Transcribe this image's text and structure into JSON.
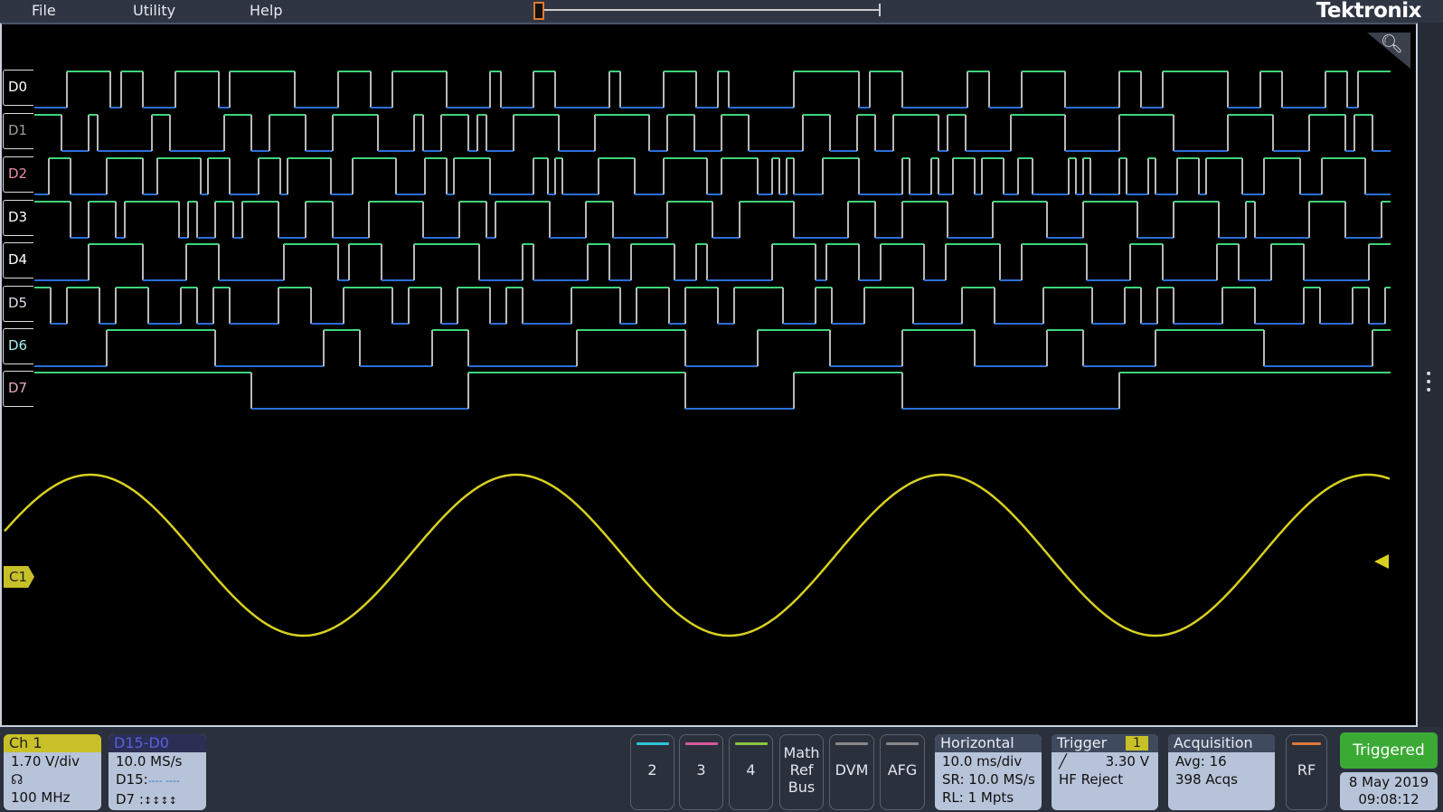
{
  "menu": {
    "items": [
      "File",
      "Utility",
      "Help"
    ],
    "brand": "Tektronix"
  },
  "digital_channels": [
    "D0",
    "D1",
    "D2",
    "D3",
    "D4",
    "D5",
    "D6",
    "D7"
  ],
  "analog_channel_label": "C1",
  "ch1": {
    "title": "Ch 1",
    "scale": "1.70 V/div",
    "bandwidth": "100 MHz",
    "probe_icon": "probe-icon"
  },
  "digital_group": {
    "title": "D15-D0",
    "rate": "10.0 MS/s",
    "d15_label": "D15:",
    "d15_state": "---- ----",
    "d7_label": "D7 :",
    "d7_state": "↕↕↕↕ ↕↕↕↕"
  },
  "channel_buttons": [
    {
      "label": "2",
      "color": "#2ec5d6"
    },
    {
      "label": "3",
      "color": "#d85a9a"
    },
    {
      "label": "4",
      "color": "#8dc63f"
    }
  ],
  "math_ref_bus": [
    "Math",
    "Ref",
    "Bus"
  ],
  "dvm": "DVM",
  "afg": "AFG",
  "horizontal": {
    "title": "Horizontal",
    "scale": "10.0 ms/div",
    "sample_rate": "SR: 10.0 MS/s",
    "record_length": "RL: 1 Mpts"
  },
  "trigger": {
    "title": "Trigger",
    "source": "1",
    "level": "3.30 V",
    "coupling": "HF Reject",
    "slope_icon": "rising-edge-icon"
  },
  "acquisition": {
    "title": "Acquisition",
    "mode": "Avg: 16",
    "count": "398 Acqs"
  },
  "rf": "RF",
  "status": {
    "state": "Triggered",
    "date": "8 May 2019",
    "time": "09:08:12"
  },
  "colors": {
    "ch1": "#d8d020",
    "high": "#3ed47a",
    "low": "#2a6fd8",
    "edge": "#b8b8b8",
    "triggered": "#3aaa35"
  }
}
